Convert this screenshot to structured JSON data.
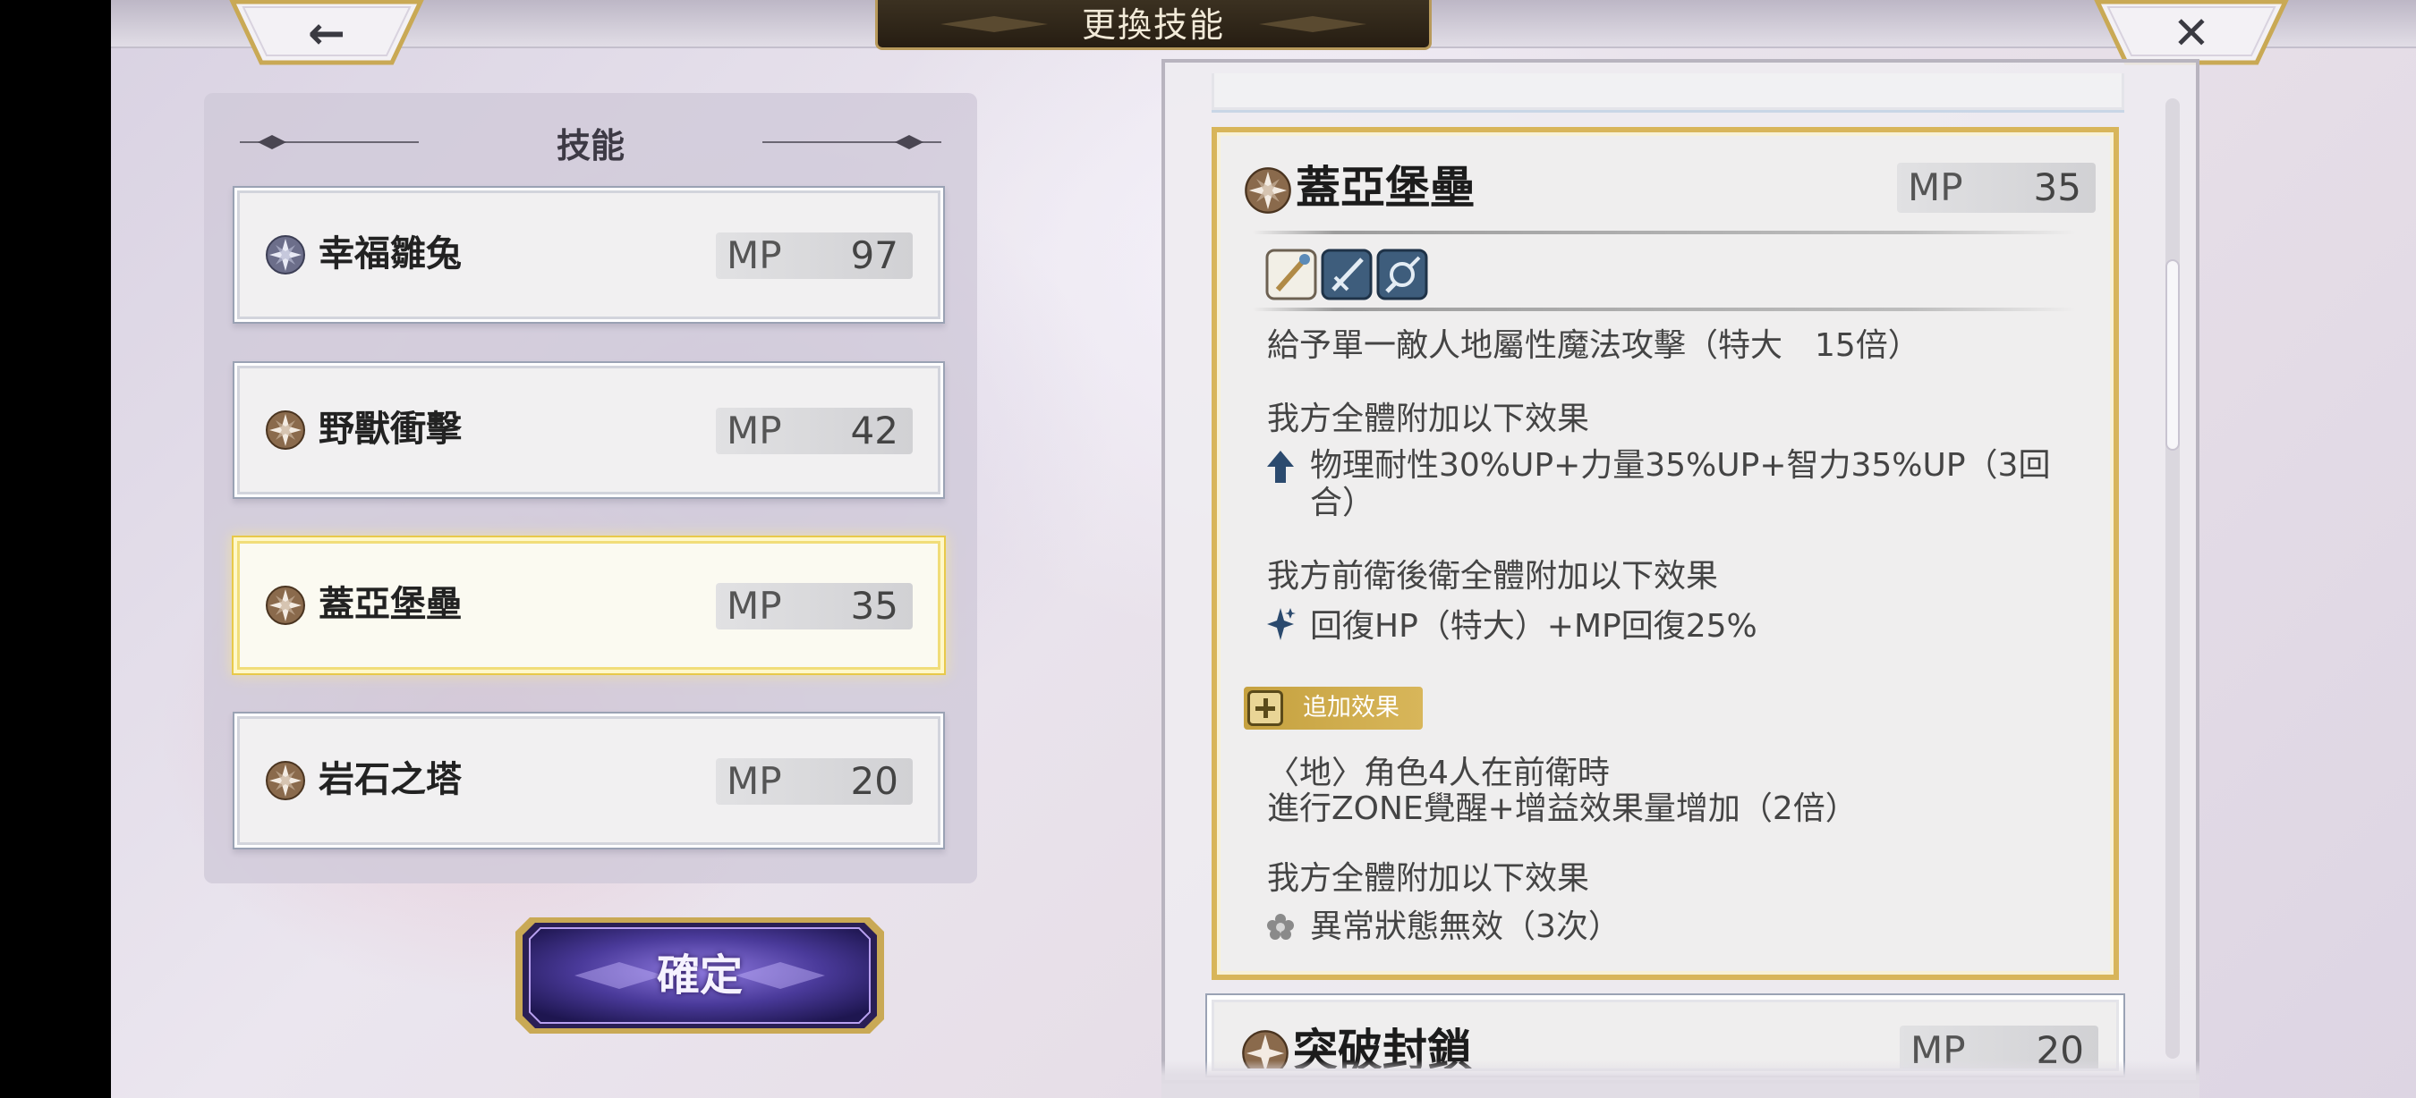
{
  "header": {
    "title": "更換技能",
    "back_icon": "←",
    "close_icon": "✕"
  },
  "left_panel": {
    "title": "技能",
    "skills": [
      {
        "name": "幸福雛兔",
        "mp_label": "MP",
        "mp": "97",
        "element": "light",
        "selected": false
      },
      {
        "name": "野獸衝擊",
        "mp_label": "MP",
        "mp": "42",
        "element": "earth",
        "selected": false
      },
      {
        "name": "蓋亞堡壘",
        "mp_label": "MP",
        "mp": "35",
        "element": "earth",
        "selected": true
      },
      {
        "name": "岩石之塔",
        "mp_label": "MP",
        "mp": "20",
        "element": "earth",
        "selected": false
      }
    ],
    "confirm_label": "確定"
  },
  "detail": {
    "name": "蓋亞堡壘",
    "mp_label": "MP",
    "mp": "35",
    "tag_icons": [
      "magic-staff-icon",
      "sword-icon",
      "target-icon"
    ],
    "line1": "給予單一敵人地屬性魔法攻擊（特大　15倍）",
    "effect1_title": "我方全體附加以下效果",
    "effect1_text": "物理耐性30%UP+力量35%UP+智力35%UP（3回合）",
    "effect2_title": "我方前衛後衛全體附加以下效果",
    "effect2_text": "回復HP（特大）+MP回復25%",
    "additional_label": "追加效果",
    "condition_line1": "〈地〉角色4人在前衛時",
    "condition_line2": "進行ZONE覺醒+增益效果量增加（2倍）",
    "effect3_title": "我方全體附加以下效果",
    "effect3_text": "異常狀態無效（3次）"
  },
  "next_skill": {
    "name": "突破封鎖",
    "mp_label": "MP",
    "mp": "20"
  },
  "colors": {
    "selected_border": "#e8c94a",
    "detail_border": "#d8b55a",
    "earth_icon": "#7a5a3a",
    "banner_bg": "#2b2216"
  }
}
